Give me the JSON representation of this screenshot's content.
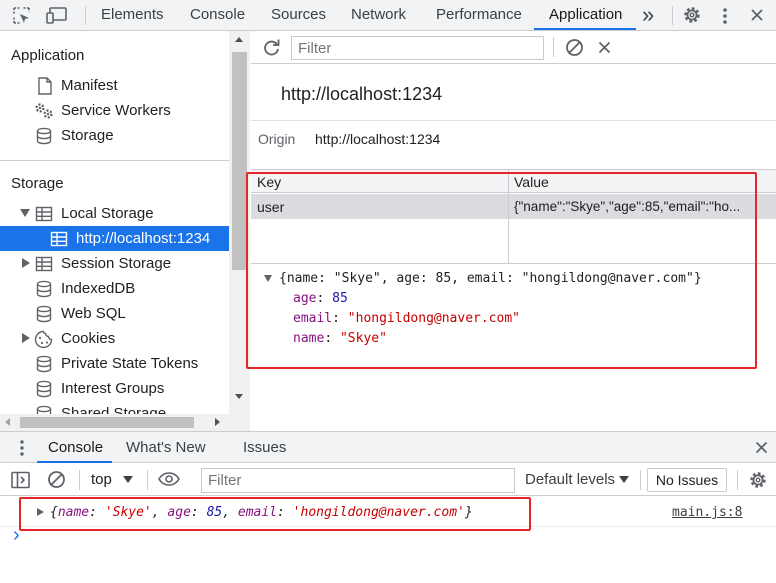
{
  "topbar": {
    "tabs": [
      "Elements",
      "Console",
      "Sources",
      "Network",
      "Performance",
      "Application"
    ],
    "active_tab": "Application",
    "more_glyph": "»",
    "icons": [
      "inspect-icon",
      "device-toggle-icon",
      "more-tabs-icon",
      "gear-icon",
      "kebab-menu-icon",
      "close-icon"
    ]
  },
  "sidebar": {
    "application_title": "Application",
    "application_items": [
      {
        "label": "Manifest",
        "icon": "document-icon"
      },
      {
        "label": "Service Workers",
        "icon": "gears-icon"
      },
      {
        "label": "Storage",
        "icon": "database-icon"
      }
    ],
    "storage_title": "Storage",
    "storage_items": [
      {
        "label": "Local Storage",
        "icon": "table-icon",
        "expanded": true
      },
      {
        "label": "http://localhost:1234",
        "icon": "table-icon",
        "selected": true
      },
      {
        "label": "Session Storage",
        "icon": "table-icon",
        "expanded": false
      },
      {
        "label": "IndexedDB",
        "icon": "database-icon"
      },
      {
        "label": "Web SQL",
        "icon": "database-icon"
      },
      {
        "label": "Cookies",
        "icon": "cookie-icon",
        "expanded": false
      },
      {
        "label": "Private State Tokens",
        "icon": "database-icon"
      },
      {
        "label": "Interest Groups",
        "icon": "database-icon"
      },
      {
        "label": "Shared Storage",
        "icon": "database-icon"
      }
    ]
  },
  "main": {
    "filter_placeholder": "Filter",
    "origin_heading": "http://localhost:1234",
    "origin_label": "Origin",
    "origin_value": "http://localhost:1234",
    "columns": [
      "Key",
      "Value"
    ],
    "rows": [
      {
        "key": "user",
        "value": "{\"name\":\"Skye\",\"age\":85,\"email\":\"ho..."
      }
    ],
    "preview": {
      "summary": "{name: \"Skye\", age: 85, email: \"hongildong@naver.com\"}",
      "props": [
        {
          "key": "age",
          "value": "85",
          "kind": "number"
        },
        {
          "key": "email",
          "value": "\"hongildong@naver.com\"",
          "kind": "string"
        },
        {
          "key": "name",
          "value": "\"Skye\"",
          "kind": "string"
        }
      ]
    }
  },
  "drawer": {
    "tabs": [
      "Console",
      "What's New",
      "Issues"
    ],
    "active_tab": "Console",
    "context": "top",
    "filter_placeholder": "Filter",
    "levels": "Default levels",
    "issues_button": "No Issues",
    "log": {
      "open": "{",
      "k1": "name",
      "v1": "'Skye'",
      "k2": "age",
      "v2": "85",
      "k3": "email",
      "v3": "'hongildong@naver.com'",
      "close": "}",
      "source": "main.js:8"
    },
    "prompt": "›"
  },
  "colors": {
    "accent": "#1a73e8",
    "highlight_box": "#e8262a",
    "property": "#881280",
    "number": "#1a1aa6",
    "string": "#c80000"
  }
}
